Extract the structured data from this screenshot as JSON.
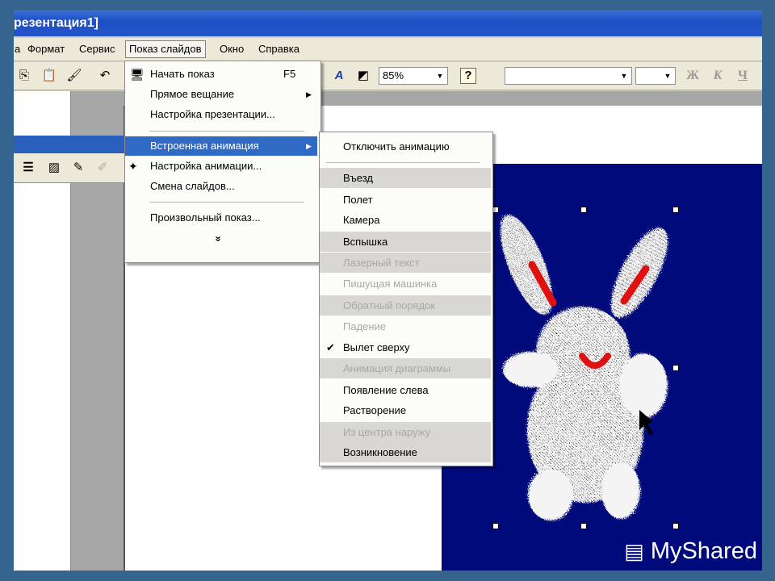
{
  "window": {
    "title": "резентация1]"
  },
  "menubar": {
    "items": [
      {
        "label": "а"
      },
      {
        "label": "Формат"
      },
      {
        "label": "Сервис"
      },
      {
        "label": "Показ слайдов"
      },
      {
        "label": "Окно"
      },
      {
        "label": "Справка"
      }
    ]
  },
  "toolbar": {
    "zoom": "85%",
    "font_combo": "",
    "size_combo": "",
    "bold": "Ж",
    "italic": "К",
    "underline": "Ч",
    "icons": [
      "copy-icon",
      "paste-icon",
      "format-painter-icon",
      "undo-icon",
      "font-color-icon",
      "fill-color-icon",
      "help-icon"
    ]
  },
  "slideshow_menu": {
    "items": [
      {
        "label": "Начать показ",
        "shortcut": "F5"
      },
      {
        "label": "Прямое вещание"
      },
      {
        "label": "Настройка презентации..."
      },
      {
        "label": "Встроенная анимация"
      },
      {
        "label": "Настройка анимации..."
      },
      {
        "label": "Смена слайдов..."
      },
      {
        "label": "Произвольный показ..."
      },
      {
        "label": "»"
      }
    ]
  },
  "animation_submenu": {
    "items": [
      {
        "label": "Отключить анимацию",
        "disabled": false
      },
      {
        "label": "Въезд",
        "disabled": false
      },
      {
        "label": "Полет",
        "disabled": false
      },
      {
        "label": "Камера",
        "disabled": false
      },
      {
        "label": "Вспышка",
        "disabled": false
      },
      {
        "label": "Лазерный текст",
        "disabled": true
      },
      {
        "label": "Пишущая машинка",
        "disabled": true
      },
      {
        "label": "Обратный порядок",
        "disabled": true
      },
      {
        "label": "Падение",
        "disabled": true
      },
      {
        "label": "Вылет сверху",
        "disabled": false,
        "checked": true
      },
      {
        "label": "Анимация диаграммы",
        "disabled": true
      },
      {
        "label": "Появление слева",
        "disabled": false
      },
      {
        "label": "Растворение",
        "disabled": false
      },
      {
        "label": "Из центра наружу",
        "disabled": true
      },
      {
        "label": "Возникновение",
        "disabled": false
      }
    ]
  },
  "watermark": "MyShared",
  "colors": {
    "accent": "#316ac5",
    "slide_bg": "#000a7a",
    "page_bg": "#35658f"
  }
}
